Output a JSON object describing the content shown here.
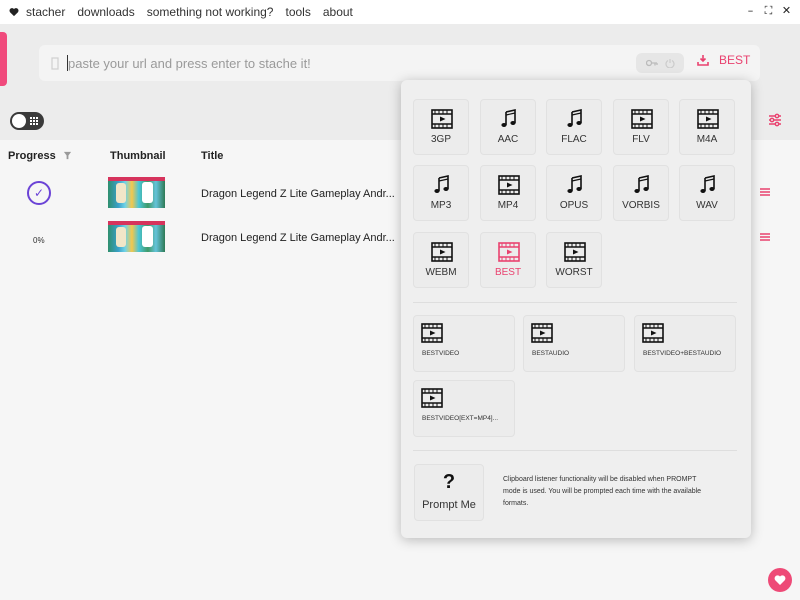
{
  "menubar": {
    "items": [
      "stacher",
      "downloads",
      "something not working?",
      "tools",
      "about"
    ],
    "window_controls": [
      "–",
      "⛶",
      "✕"
    ]
  },
  "url_bar": {
    "placeholder": "paste your url and press enter to stache it!",
    "format_label": "BEST"
  },
  "table": {
    "headers": {
      "progress": "Progress",
      "thumbnail": "Thumbnail",
      "title": "Title"
    },
    "rows": [
      {
        "progress_state": "complete",
        "progress_text": "",
        "title": "Dragon Legend Z Lite Gameplay Andr..."
      },
      {
        "progress_state": "pending",
        "progress_text": "0%",
        "title": "Dragon Legend Z Lite Gameplay Andr..."
      }
    ]
  },
  "format_menu": {
    "formats": [
      {
        "label": "3GP",
        "icon": "film-icon"
      },
      {
        "label": "AAC",
        "icon": "music-icon"
      },
      {
        "label": "FLAC",
        "icon": "music-icon"
      },
      {
        "label": "FLV",
        "icon": "film-icon"
      },
      {
        "label": "M4A",
        "icon": "film-icon"
      },
      {
        "label": "MP3",
        "icon": "music-icon"
      },
      {
        "label": "MP4",
        "icon": "film-icon"
      },
      {
        "label": "OPUS",
        "icon": "music-icon"
      },
      {
        "label": "VORBIS",
        "icon": "music-icon"
      },
      {
        "label": "WAV",
        "icon": "music-icon"
      },
      {
        "label": "WEBM",
        "icon": "film-icon"
      },
      {
        "label": "BEST",
        "icon": "film-icon",
        "selected": true
      },
      {
        "label": "WORST",
        "icon": "film-icon"
      }
    ],
    "combined_formats": [
      {
        "label": "BESTVIDEO",
        "icon": "film-icon"
      },
      {
        "label": "BESTAUDIO",
        "icon": "film-icon"
      },
      {
        "label": "BESTVIDEO+BESTAUDIO",
        "icon": "film-icon"
      },
      {
        "label": "BESTVIDEO[EXT=MP4]...",
        "icon": "film-icon"
      }
    ],
    "prompt": {
      "symbol": "?",
      "label": "Prompt Me",
      "note": "Clipboard listener functionality will be disabled when PROMPT mode is used. You will be prompted each time with the available formats."
    }
  },
  "colors": {
    "accent": "#e9426f",
    "progress_complete": "#6b43d6",
    "toggle": "#3a3a3a"
  }
}
